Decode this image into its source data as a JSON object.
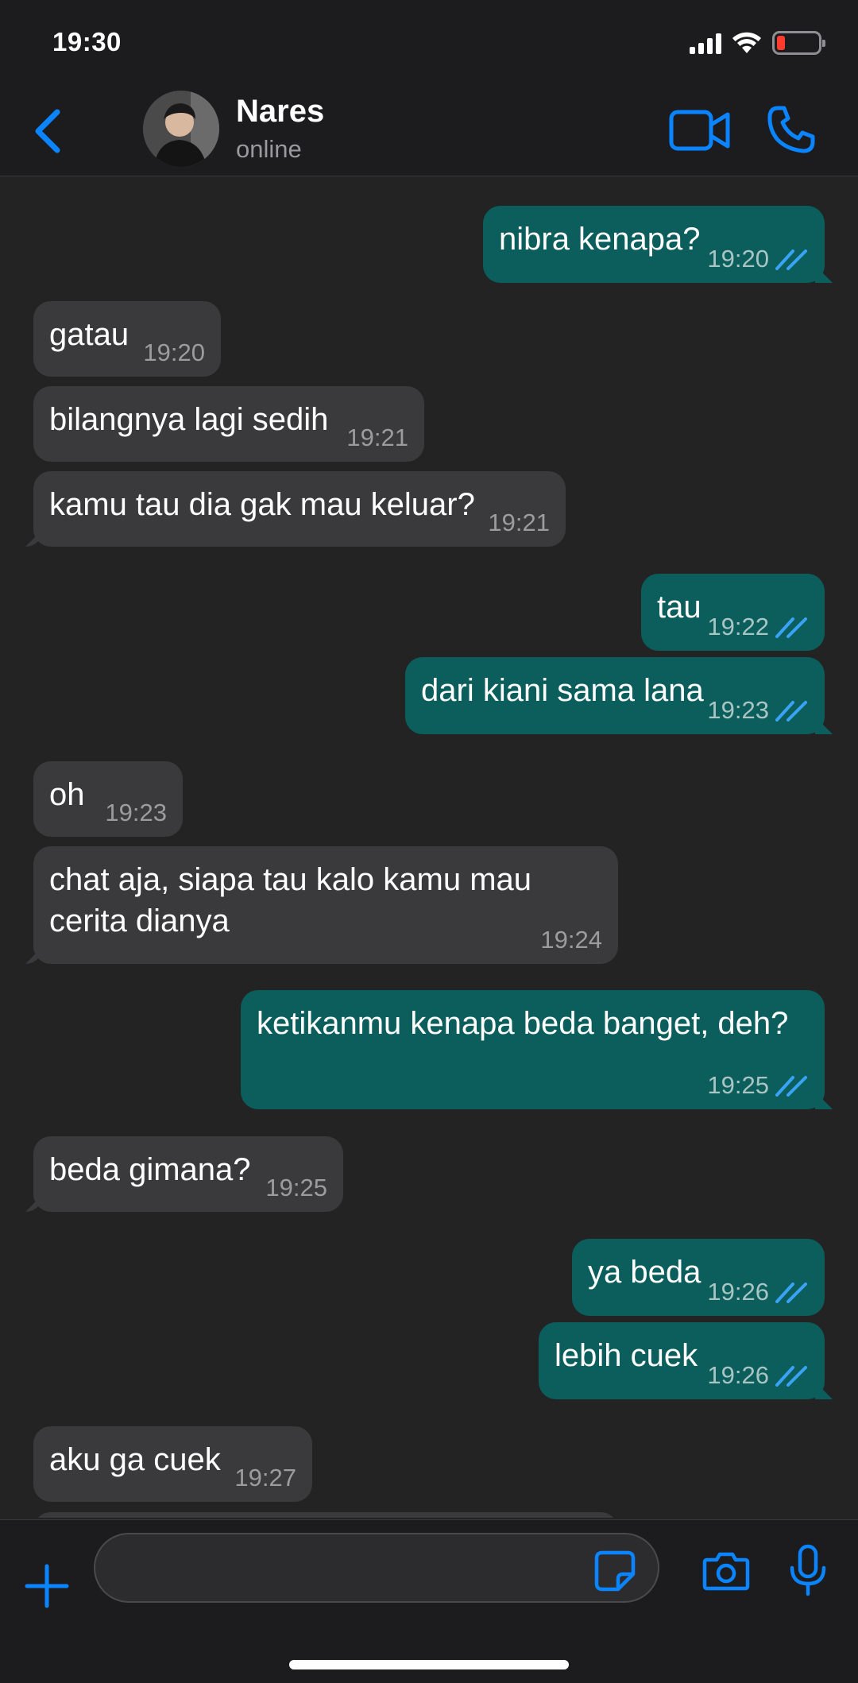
{
  "status_bar": {
    "time": "19:30"
  },
  "header": {
    "contact_name": "Nares",
    "contact_status": "online",
    "accent_color": "#0a84ff"
  },
  "messages": [
    {
      "direction": "out",
      "text": "nibra kenapa?",
      "time": "19:20",
      "read": true
    },
    {
      "direction": "in",
      "text": "gatau",
      "time": "19:20"
    },
    {
      "direction": "in",
      "text": "bilangnya lagi sedih",
      "time": "19:21"
    },
    {
      "direction": "in",
      "text": "kamu tau dia gak mau keluar?",
      "time": "19:21"
    },
    {
      "direction": "out",
      "text": "tau",
      "time": "19:22",
      "read": true
    },
    {
      "direction": "out",
      "text": "dari kiani sama lana",
      "time": "19:23",
      "read": true
    },
    {
      "direction": "in",
      "text": "oh",
      "time": "19:23"
    },
    {
      "direction": "in",
      "text": "chat aja, siapa tau kalo kamu mau cerita dianya",
      "time": "19:24"
    },
    {
      "direction": "out",
      "text": "ketikanmu kenapa beda banget, deh?",
      "time": "19:25",
      "read": true
    },
    {
      "direction": "in",
      "text": "beda gimana?",
      "time": "19:25"
    },
    {
      "direction": "out",
      "text": "ya beda",
      "time": "19:26",
      "read": true
    },
    {
      "direction": "out",
      "text": "lebih cuek",
      "time": "19:26",
      "read": true
    },
    {
      "direction": "in",
      "text": "aku ga cuek",
      "time": "19:27"
    }
  ],
  "composer": {
    "value": "",
    "placeholder": ""
  },
  "colors": {
    "incoming_bubble": "#3a3a3c",
    "outgoing_bubble": "#0b5e5c",
    "read_ticks": "#3aa3f5",
    "battery_low": "#ff3b30"
  }
}
